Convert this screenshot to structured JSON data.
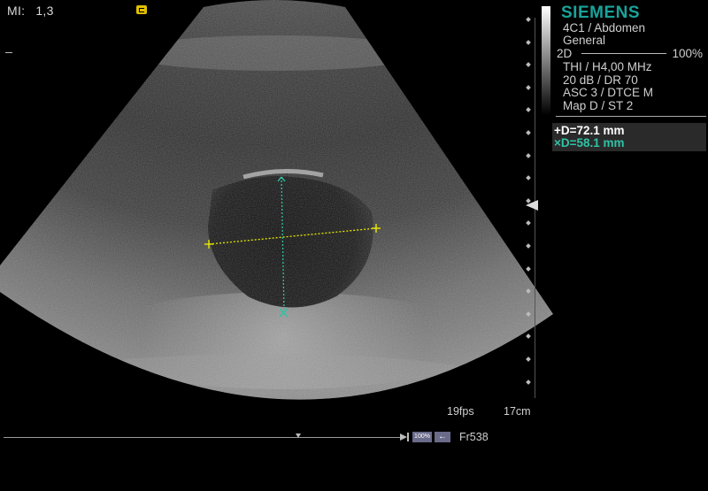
{
  "header": {
    "mi_label": "MI:",
    "mi_value": "1,3"
  },
  "panel": {
    "brand": "SIEMENS",
    "transducer": "4C1 / Abdomen",
    "preset": "General",
    "mode": "2D",
    "power": "100%",
    "params": [
      "THI / H4,00 MHz",
      "20 dB / DR 70",
      "ASC 3 / DTCE M",
      "Map D / ST 2"
    ]
  },
  "measurements": [
    {
      "label": "+D=72.1 mm",
      "color": "#ffffff"
    },
    {
      "label": "×D=58.1 mm",
      "color": "#2fc3a6"
    }
  ],
  "status": {
    "frame_rate": "19fps",
    "depth": "17cm",
    "zoom": "100%",
    "frame": "Fr538"
  },
  "colors": {
    "brand": "#19a39a",
    "caliper_1": "#e8e800",
    "caliper_2": "#2fc3a6"
  },
  "icons": [
    "gel-icon",
    "focus-arrow-icon",
    "back-arrow-icon"
  ]
}
